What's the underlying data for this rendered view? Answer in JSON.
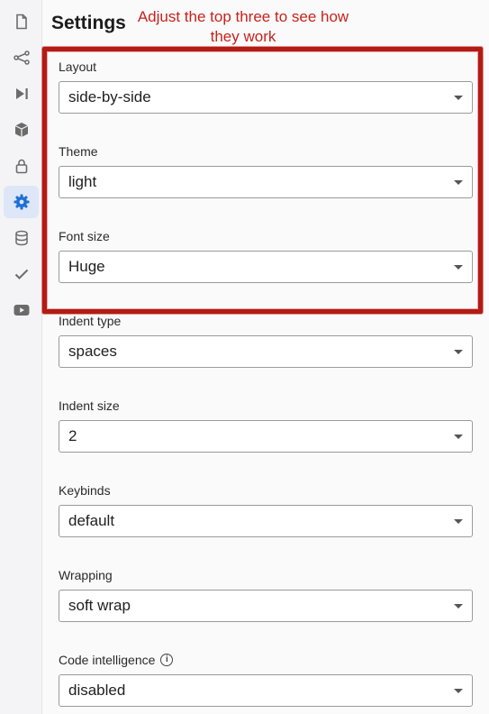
{
  "sidebar": {
    "icons": [
      {
        "name": "file-icon"
      },
      {
        "name": "share-nodes-icon"
      },
      {
        "name": "play-next-icon"
      },
      {
        "name": "package-icon"
      },
      {
        "name": "lock-icon"
      },
      {
        "name": "settings-gear-icon",
        "active": true
      },
      {
        "name": "database-icon"
      },
      {
        "name": "check-icon"
      },
      {
        "name": "youtube-icon"
      }
    ]
  },
  "panel": {
    "title": "Settings",
    "annotation": "Adjust the top three to see how they work",
    "annotation_color": "#c8221c",
    "highlight_color": "#b51a14"
  },
  "settings": {
    "layout": {
      "label": "Layout",
      "value": "side-by-side"
    },
    "theme": {
      "label": "Theme",
      "value": "light"
    },
    "font_size": {
      "label": "Font size",
      "value": "Huge"
    },
    "indent_type": {
      "label": "Indent type",
      "value": "spaces"
    },
    "indent_size": {
      "label": "Indent size",
      "value": "2"
    },
    "keybinds": {
      "label": "Keybinds",
      "value": "default"
    },
    "wrapping": {
      "label": "Wrapping",
      "value": "soft wrap"
    },
    "code_intelligence": {
      "label": "Code intelligence",
      "value": "disabled",
      "info_glyph": "i"
    }
  },
  "colors": {
    "accent": "#1f6fd6",
    "icon_gray": "#6b6b6b"
  }
}
